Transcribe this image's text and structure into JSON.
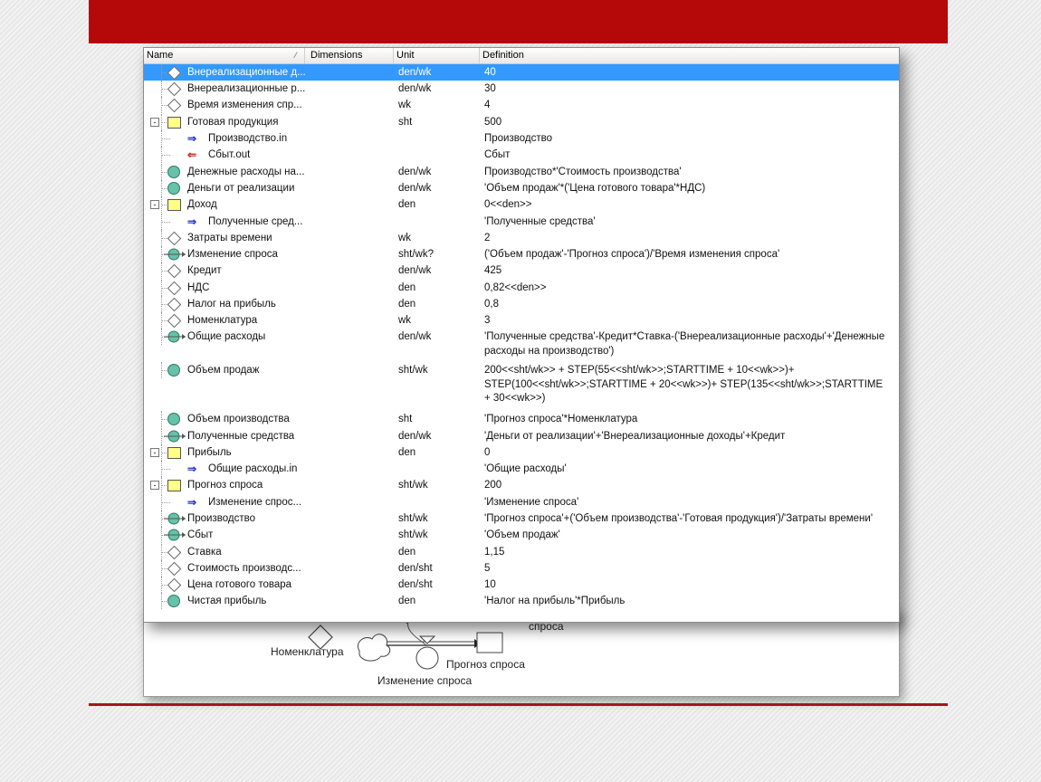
{
  "columns": {
    "name": "Name",
    "dimensions": "Dimensions",
    "unit": "Unit",
    "definition": "Definition"
  },
  "diagram_labels": {
    "nomenclature": "Номенклатура",
    "demand_change": "Изменение спроса",
    "forecast": "Прогноз спроса",
    "spros": "спроса"
  },
  "colors": {
    "header_bar": "#b50909",
    "selection": "#3399ff",
    "auxiliary_flow_icon": "#66c2a8",
    "stock_icon": "#ffff88"
  },
  "rows": [
    {
      "name": "Внереализационные д...",
      "unit": "den/wk",
      "def": "40",
      "icon": "diamond-icon",
      "level": 0,
      "selected": true
    },
    {
      "name": "Внереализационные р...",
      "unit": "den/wk",
      "def": "30",
      "icon": "diamond-icon",
      "level": 0
    },
    {
      "name": "Время изменения спр...",
      "unit": "wk",
      "def": "4",
      "icon": "diamond-icon",
      "level": 0
    },
    {
      "name": "Готовая продукция",
      "unit": "sht",
      "def": "500",
      "icon": "stock-icon",
      "level": 0,
      "toggle": "-"
    },
    {
      "name": "Производство.in",
      "unit": "",
      "def": "Производство",
      "icon": "inflow-icon",
      "level": 1
    },
    {
      "name": "Сбыт.out",
      "unit": "",
      "def": "Сбыт",
      "icon": "outflow-icon",
      "level": 1
    },
    {
      "name": "Денежные расходы на...",
      "unit": "den/wk",
      "def": "Производство*'Стоимость производства'",
      "icon": "circle-icon",
      "level": 0
    },
    {
      "name": "Деньги от реализации",
      "unit": "den/wk",
      "def": "'Объем продаж'*('Цена готового товара'*НДС)",
      "icon": "circle-icon",
      "level": 0
    },
    {
      "name": "Доход",
      "unit": "den",
      "def": "0<<den>>",
      "icon": "stock-icon",
      "level": 0,
      "toggle": "-"
    },
    {
      "name": "Полученные сред...",
      "unit": "",
      "def": "'Полученные средства'",
      "icon": "inflow-icon",
      "level": 1
    },
    {
      "name": "Затраты времени",
      "unit": "wk",
      "def": "2",
      "icon": "diamond-icon",
      "level": 0
    },
    {
      "name": "Изменение спроса",
      "unit": "sht/wk?",
      "def": "('Объем продаж'-'Прогноз спроса')/'Время изменения спроса'",
      "icon": "flow-icon",
      "level": 0
    },
    {
      "name": "Кредит",
      "unit": "den/wk",
      "def": "425",
      "icon": "diamond-icon",
      "level": 0
    },
    {
      "name": "НДС",
      "unit": "den",
      "def": "0,82<<den>>",
      "icon": "diamond-icon",
      "level": 0
    },
    {
      "name": "Налог на прибыль",
      "unit": "den",
      "def": "0,8",
      "icon": "diamond-icon",
      "level": 0
    },
    {
      "name": "Номенклатура",
      "unit": "wk",
      "def": "3",
      "icon": "diamond-icon",
      "level": 0
    },
    {
      "name": "Общие расходы",
      "unit": "den/wk",
      "def": "'Полученные средства'-Кредит*Ставка-('Внереализационные расходы'+'Денежные расходы на производство')",
      "icon": "flow-icon",
      "level": 0
    },
    {
      "name": "Объем продаж",
      "unit": "sht/wk",
      "def": "200<<sht/wk>> + STEP(55<<sht/wk>>;STARTTIME + 10<<wk>>)+ STEP(100<<sht/wk>>;STARTTIME + 20<<wk>>)+ STEP(135<<sht/wk>>;STARTTIME + 30<<wk>>)",
      "icon": "circle-icon",
      "level": 0
    },
    {
      "name": "Объем производства",
      "unit": "sht",
      "def": "'Прогноз спроса'*Номенклатура",
      "icon": "circle-icon",
      "level": 0
    },
    {
      "name": "Полученные средства",
      "unit": "den/wk",
      "def": "'Деньги от реализации'+'Внереализационные доходы'+Кредит",
      "icon": "flow-icon",
      "level": 0
    },
    {
      "name": "Прибыль",
      "unit": "den",
      "def": "0",
      "icon": "stock-icon",
      "level": 0,
      "toggle": "-"
    },
    {
      "name": "Общие расходы.in",
      "unit": "",
      "def": "'Общие расходы'",
      "icon": "inflow-icon",
      "level": 1
    },
    {
      "name": "Прогноз спроса",
      "unit": "sht/wk",
      "def": "200",
      "icon": "stock-icon",
      "level": 0,
      "toggle": "-"
    },
    {
      "name": "Изменение спрос...",
      "unit": "",
      "def": "'Изменение спроса'",
      "icon": "inflow-icon",
      "level": 1
    },
    {
      "name": "Производство",
      "unit": "sht/wk",
      "def": "'Прогноз спроса'+('Объем производства'-'Готовая продукция')/'Затраты времени'",
      "icon": "flow-icon",
      "level": 0
    },
    {
      "name": "Сбыт",
      "unit": "sht/wk",
      "def": "'Объем продаж'",
      "icon": "flow-icon",
      "level": 0
    },
    {
      "name": "Ставка",
      "unit": "den",
      "def": "1,15",
      "icon": "diamond-icon",
      "level": 0
    },
    {
      "name": "Стоимость производс...",
      "unit": "den/sht",
      "def": "5",
      "icon": "diamond-icon",
      "level": 0
    },
    {
      "name": "Цена готового товара",
      "unit": "den/sht",
      "def": "10",
      "icon": "diamond-icon",
      "level": 0
    },
    {
      "name": "Чистая прибыль",
      "unit": "den",
      "def": "'Налог на прибыль'*Прибыль",
      "icon": "circle-icon",
      "level": 0
    }
  ]
}
